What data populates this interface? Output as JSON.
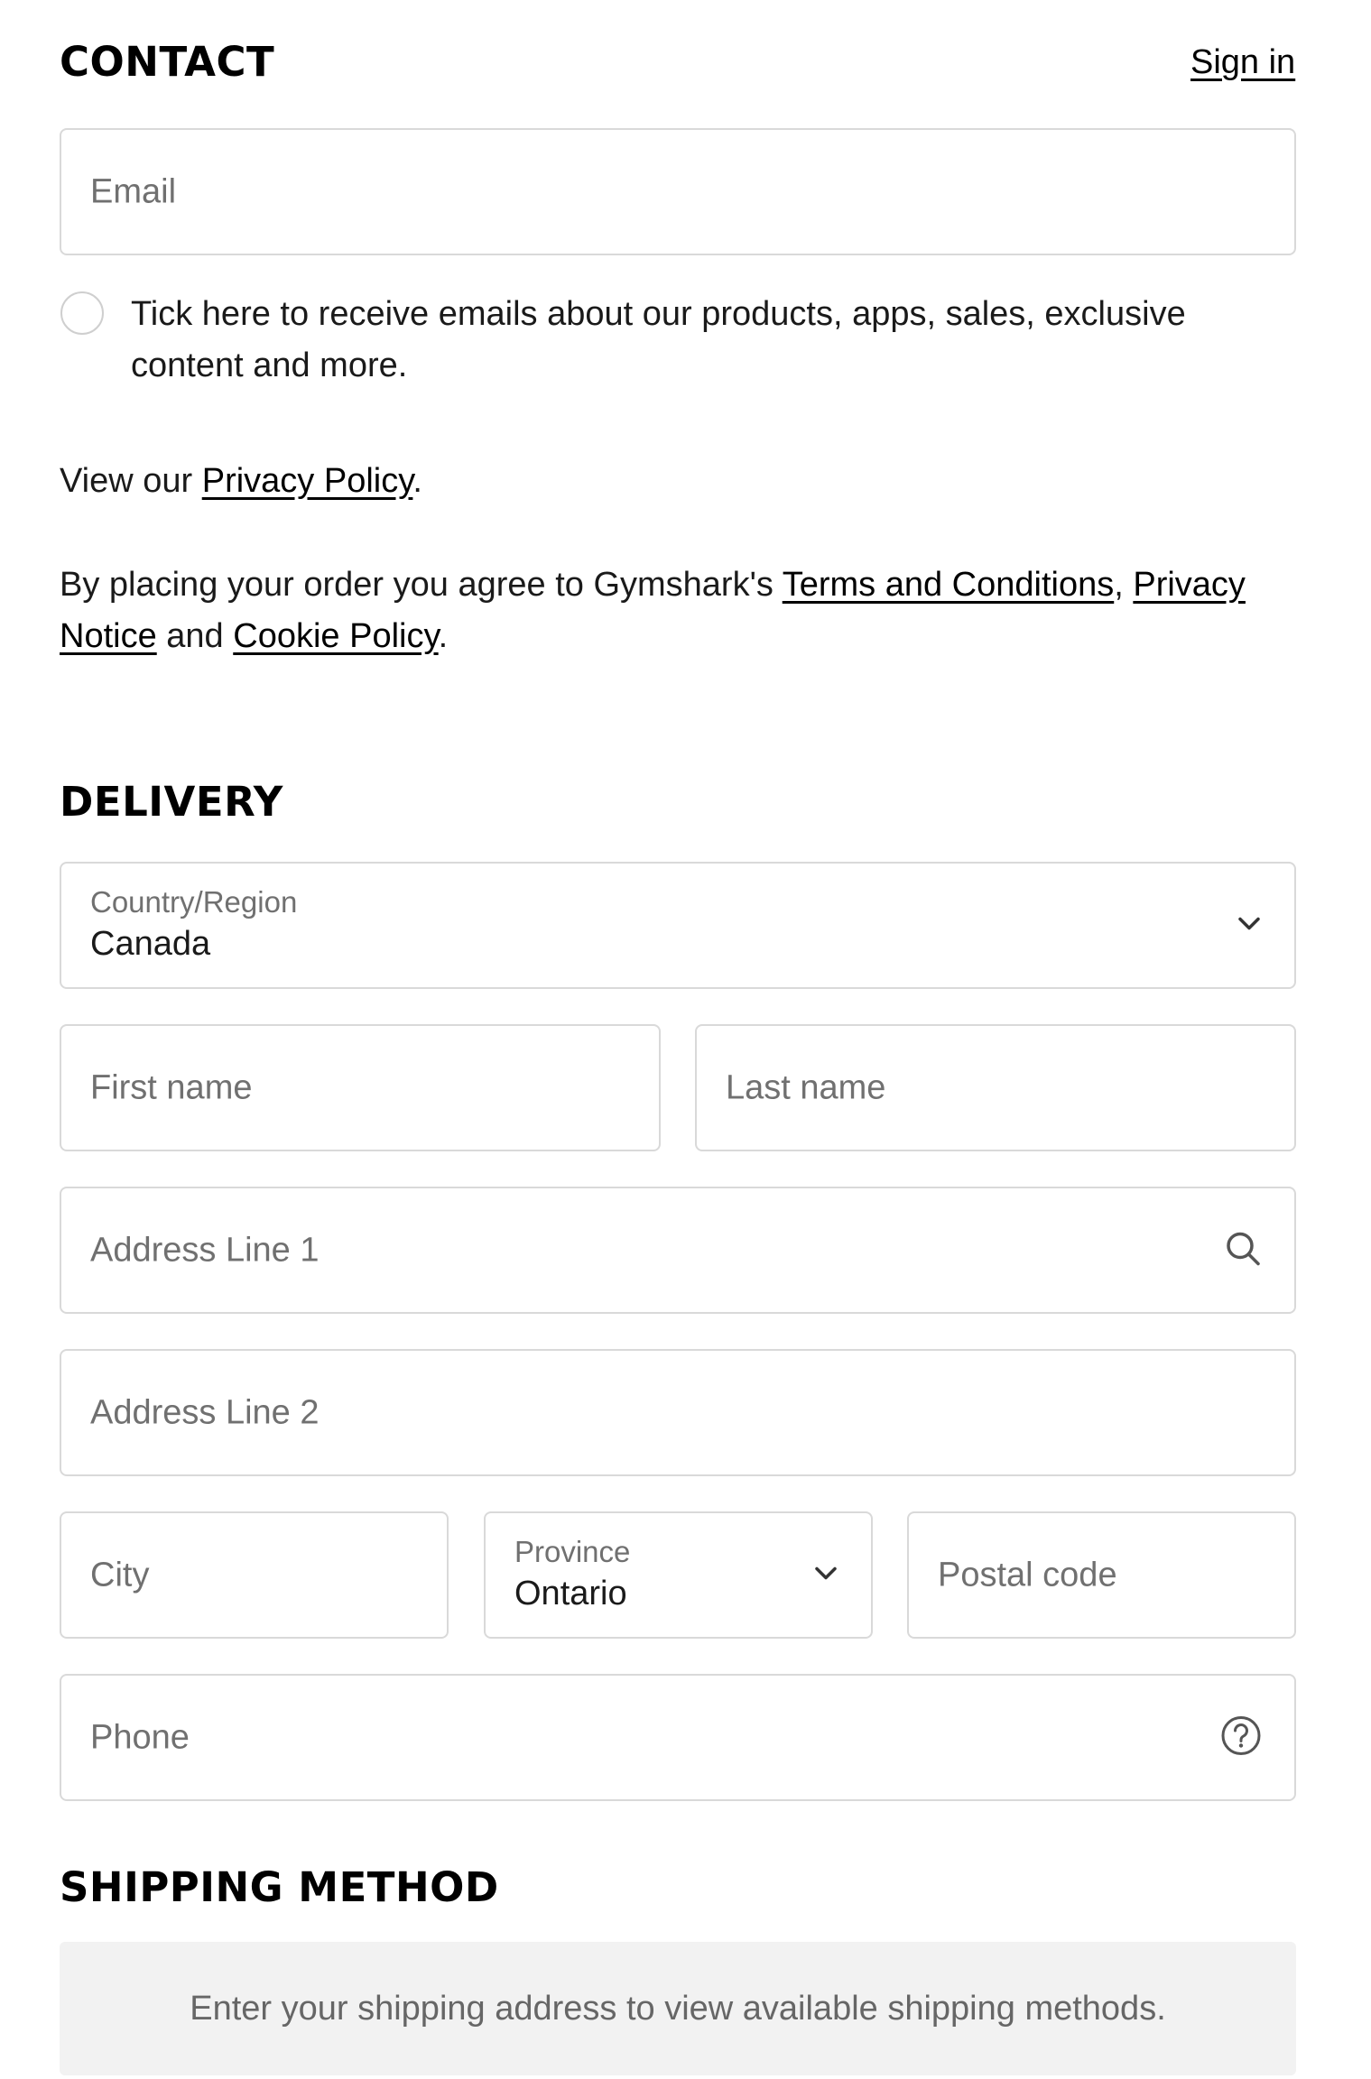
{
  "contact": {
    "title": "CONTACT",
    "sign_in": "Sign in",
    "email_placeholder": "Email",
    "marketing_text_line1": "Tick here to receive emails about our products, apps, sales, exclusive",
    "marketing_text_line2": "content and more.",
    "privacy_prefix": "View our ",
    "privacy_link": "Privacy Policy",
    "privacy_suffix": ".",
    "terms_prefix": "By placing your order you agree to Gymshark's ",
    "terms_link": "Terms and Conditions",
    "terms_comma": ", ",
    "privacy_notice_link_part1": "Privacy",
    "privacy_notice_link_part2": "Notice",
    "and_text": " and ",
    "cookie_link": "Cookie Policy",
    "terms_suffix": "."
  },
  "delivery": {
    "title": "DELIVERY",
    "country_label": "Country/Region",
    "country_value": "Canada",
    "first_name_placeholder": "First name",
    "last_name_placeholder": "Last name",
    "address1_placeholder": "Address Line 1",
    "address2_placeholder": "Address Line 2",
    "city_placeholder": "City",
    "province_label": "Province",
    "province_value": "Ontario",
    "postal_placeholder": "Postal code",
    "phone_placeholder": "Phone"
  },
  "shipping": {
    "title": "SHIPPING METHOD",
    "notice": "Enter your shipping address to view available shipping methods."
  },
  "icons": {
    "country_dropdown": "chevron-down-icon",
    "address_search": "search-icon",
    "province_dropdown": "chevron-down-icon",
    "phone_help": "question-circle-icon"
  }
}
